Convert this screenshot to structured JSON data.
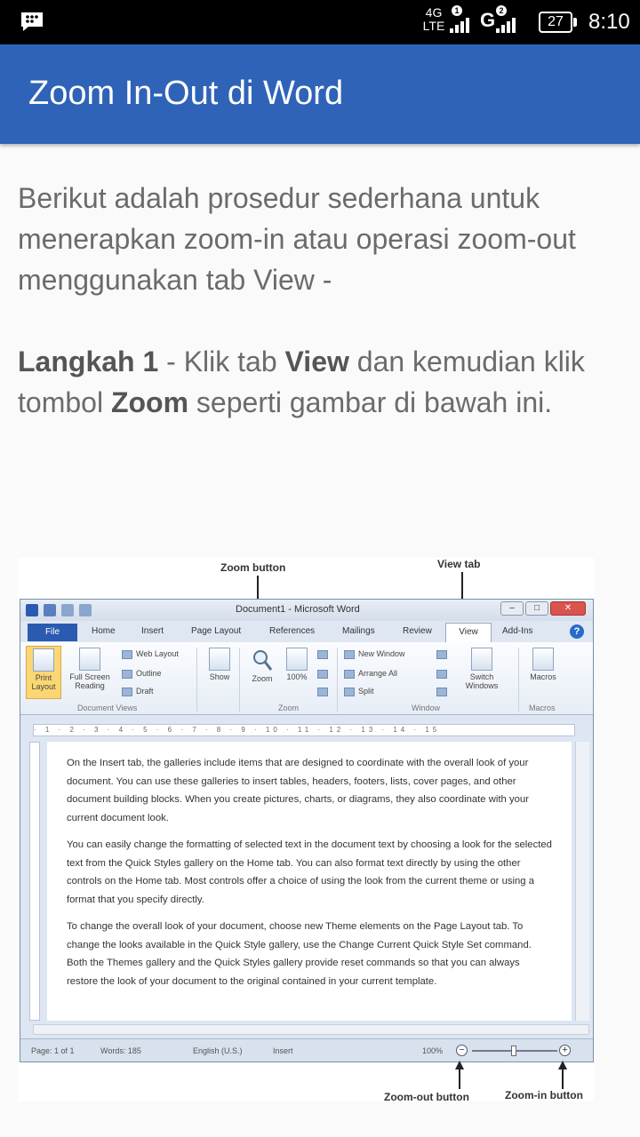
{
  "status_bar": {
    "network_type": "4G",
    "network_sub": "LTE",
    "sim1_badge": "1",
    "sim2_badge": "2",
    "sim2_network": "G",
    "battery_level": "27",
    "time": "8:10"
  },
  "app_bar": {
    "title": "Zoom In-Out di Word"
  },
  "content": {
    "intro": "Berikut adalah prosedur sederhana untuk menerapkan zoom-in atau operasi zoom-out menggunakan tab View -",
    "step_label": "Langkah 1",
    "step_text_1": " - Klik tab ",
    "step_bold_view": "View",
    "step_text_2": " dan kemudian klik tombol ",
    "step_bold_zoom": "Zoom",
    "step_text_3": " seperti gambar di bawah ini."
  },
  "figure": {
    "callouts": {
      "zoom_button": "Zoom button",
      "view_tab": "View tab",
      "zoom_out_button": "Zoom-out button",
      "zoom_in_button": "Zoom-in button"
    },
    "window_title": "Document1 - Microsoft Word",
    "tabs": [
      "File",
      "Home",
      "Insert",
      "Page Layout",
      "References",
      "Mailings",
      "Review",
      "View",
      "Add-Ins"
    ],
    "ribbon": {
      "print_layout": "Print Layout",
      "full_screen_reading": "Full Screen Reading",
      "web_layout": "Web Layout",
      "outline": "Outline",
      "draft": "Draft",
      "document_views": "Document Views",
      "show": "Show",
      "zoom": "Zoom",
      "zoom_100": "100%",
      "zoom_group": "Zoom",
      "new_window": "New Window",
      "arrange_all": "Arrange All",
      "split": "Split",
      "switch_windows": "Switch Windows",
      "window_group": "Window",
      "macros": "Macros",
      "macros_group": "Macros"
    },
    "ruler_text": "· 1 · 2 · 3 · 4 · 5 · 6 · 7 · 8 · 9 · 10 · 11 · 12 · 13 · 14 · 15",
    "document_paragraphs": [
      "On the Insert tab, the galleries include items that are designed to coordinate with the overall look of your document. You can use these galleries to insert tables, headers, footers, lists, cover pages, and other document building blocks. When you create pictures, charts, or diagrams, they also coordinate with your current document look.",
      "You can easily change the formatting of selected text in the document text by choosing a look for the selected text from the Quick Styles gallery on the Home tab. You can also format text directly by using the other controls on the Home tab. Most controls offer a choice of using the look from the current theme or using a format that you specify directly.",
      "To change the overall look of your document, choose new Theme elements on the Page Layout tab. To change the looks available in the Quick Style gallery, use the Change Current Quick Style Set command. Both the Themes gallery and the Quick Styles gallery provide reset commands so that you can always restore the look of your document to the original contained in your current template."
    ],
    "status": {
      "page": "Page: 1 of 1",
      "words": "Words: 185",
      "language": "English (U.S.)",
      "mode": "Insert",
      "zoom_level": "100%"
    }
  },
  "colors": {
    "app_bar": "#2f63b8",
    "status_bar": "#000000",
    "body_text": "#6b6b6b"
  }
}
